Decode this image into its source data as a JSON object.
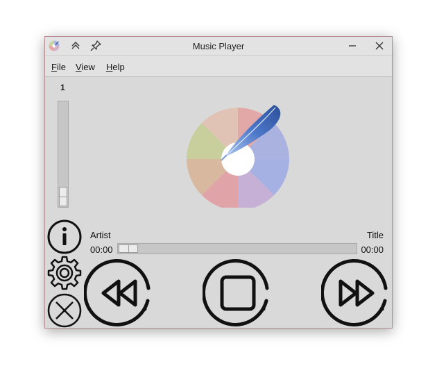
{
  "window": {
    "title": "Music Player",
    "controls": {
      "minimize_icon": "minimize-icon",
      "close_icon": "close-icon",
      "keep_above_icon": "keep-above-icon",
      "pin_icon": "pin-icon"
    }
  },
  "menu": {
    "file": {
      "mnemonic": "F",
      "rest": "ile"
    },
    "view": {
      "mnemonic": "V",
      "rest": "iew"
    },
    "help": {
      "mnemonic": "H",
      "rest": "elp"
    }
  },
  "volume": {
    "value": "1",
    "level_fraction": 0.0
  },
  "track": {
    "artist_label": "Artist",
    "title_label": "Title",
    "elapsed": "00:00",
    "duration": "00:00",
    "progress_fraction": 0.0
  },
  "buttons": {
    "info": "info-icon",
    "settings": "gear-icon",
    "quit": "close-icon",
    "rewind": "rewind-icon",
    "stop": "stop-icon",
    "fast_forward": "fast-forward-icon"
  },
  "colors": {
    "window_bg": "#d9d9d9",
    "titlebar_bg": "#e3e3e3",
    "border_accent": "#b48a8f",
    "icon_stroke": "#111111"
  }
}
